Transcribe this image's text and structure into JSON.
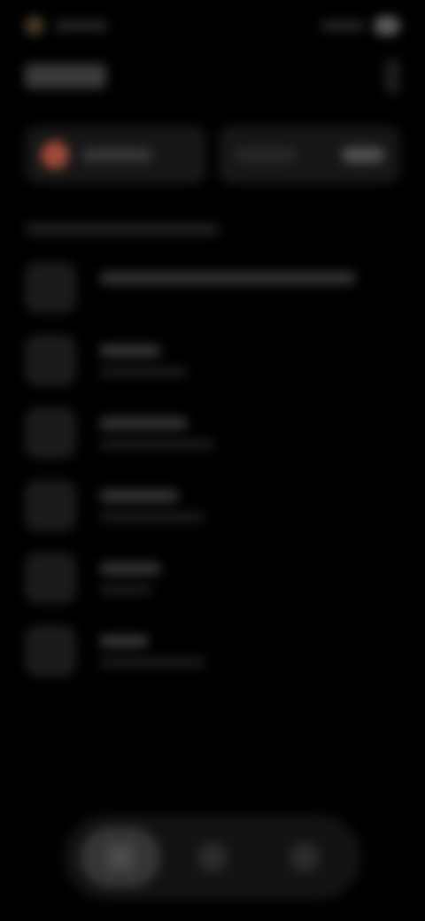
{
  "status_bar": {},
  "header": {},
  "cards": [
    {
      "icon": "record-icon",
      "accent": "#a04a3a"
    },
    {
      "icon": "toggle-icon"
    }
  ],
  "list": {
    "items": [
      {
        "icon": "item-icon"
      },
      {
        "icon": "item-icon"
      },
      {
        "icon": "item-icon"
      },
      {
        "icon": "item-icon"
      },
      {
        "icon": "item-icon"
      },
      {
        "icon": "item-icon"
      }
    ]
  },
  "bottom_nav": {
    "items": [
      {
        "icon": "home-icon",
        "active": true
      },
      {
        "icon": "search-icon",
        "active": false
      },
      {
        "icon": "profile-icon",
        "active": false
      }
    ]
  },
  "colors": {
    "background": "#000000",
    "card": "#161616",
    "record_accent": "#a04a3a",
    "nav_active": "#353535"
  }
}
